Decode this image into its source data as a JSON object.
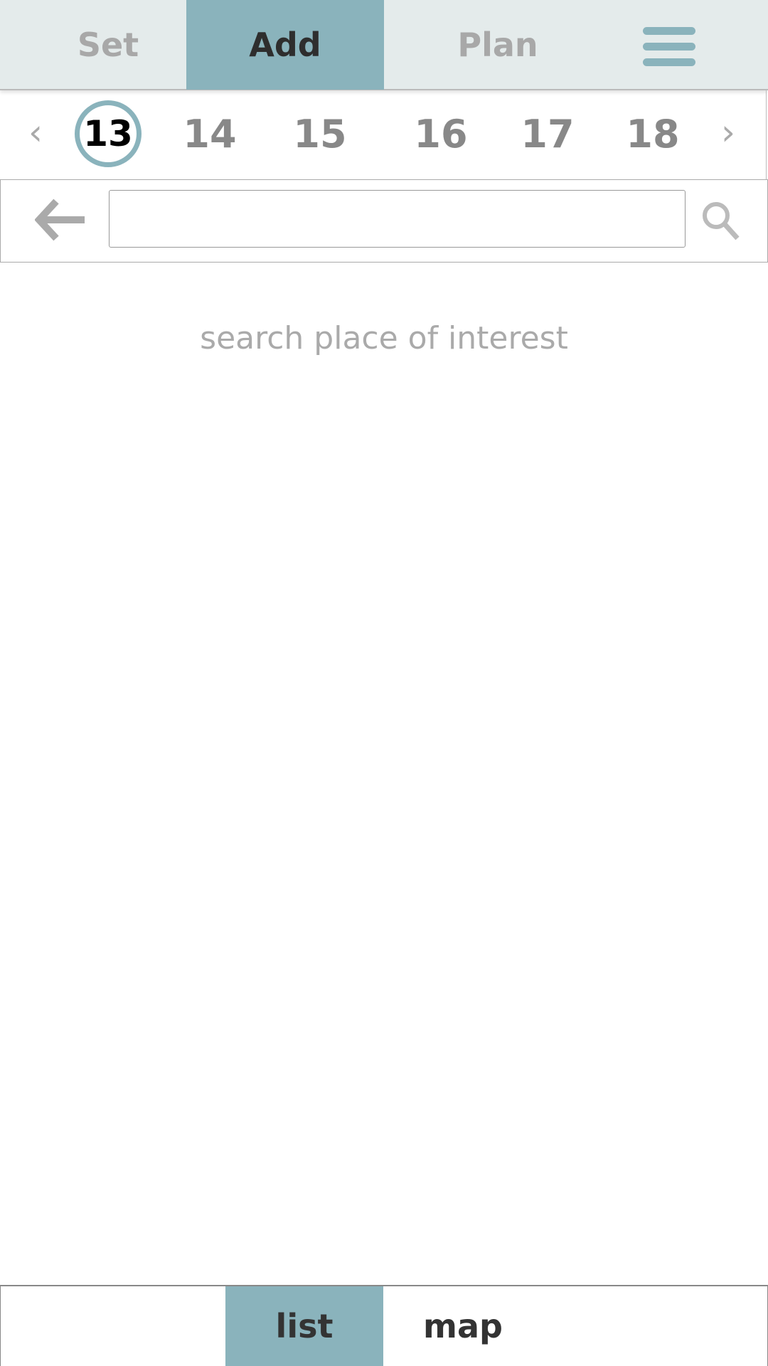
{
  "header": {
    "tabs": [
      {
        "label": "Set"
      },
      {
        "label": "Add",
        "active": true
      },
      {
        "label": "Plan"
      }
    ],
    "menu_icon": "hamburger-icon"
  },
  "dates": {
    "items": [
      "13",
      "14",
      "15",
      "16",
      "17",
      "18"
    ],
    "selected": "13",
    "prev_icon": "chevron-left-icon",
    "next_icon": "chevron-right-icon"
  },
  "search": {
    "value": "",
    "placeholder": "",
    "back_icon": "arrow-left-icon",
    "search_icon": "search-icon"
  },
  "hint": "search place of interest",
  "bottom": {
    "tabs": [
      {
        "label": "list",
        "active": true
      },
      {
        "label": "map"
      }
    ]
  },
  "colors": {
    "accent": "#8ab3bc",
    "header_bg": "#e4ebeb"
  }
}
